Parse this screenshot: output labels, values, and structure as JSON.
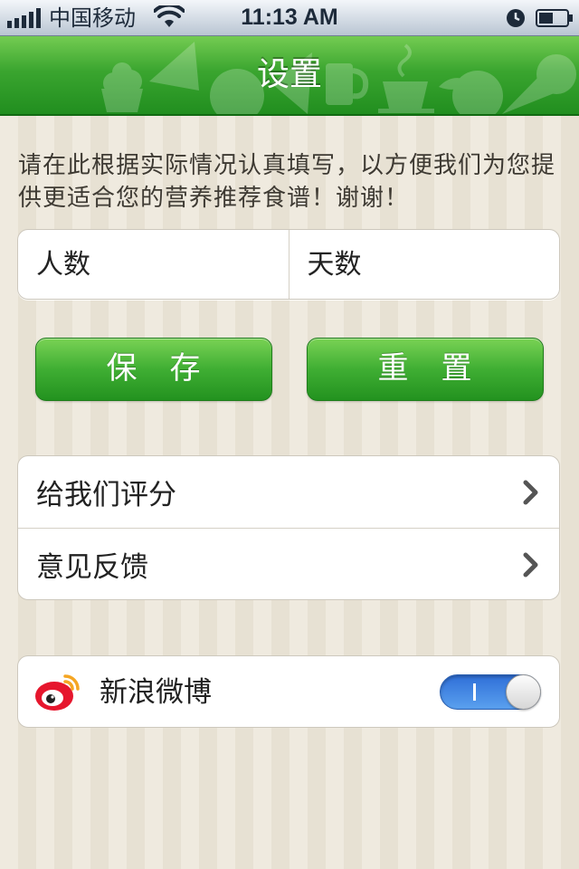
{
  "status_bar": {
    "carrier": "中国移动",
    "time": "11:13 AM"
  },
  "nav": {
    "title": "设置"
  },
  "intro": {
    "text": "请在此根据实际情况认真填写，以方便我们为您提供更适合您的营养推荐食谱！谢谢！"
  },
  "inputs": {
    "people_placeholder": "人数",
    "days_placeholder": "天数"
  },
  "buttons": {
    "save_label": "保　存",
    "reset_label": "重　置"
  },
  "menu": {
    "items": [
      {
        "label": "给我们评分"
      },
      {
        "label": "意见反馈"
      }
    ]
  },
  "weibo": {
    "label": "新浪微博",
    "toggle_on": true
  },
  "colors": {
    "accent_green": "#3aa52f",
    "toggle_blue": "#2f6fd8",
    "background": "#ede8dc"
  }
}
